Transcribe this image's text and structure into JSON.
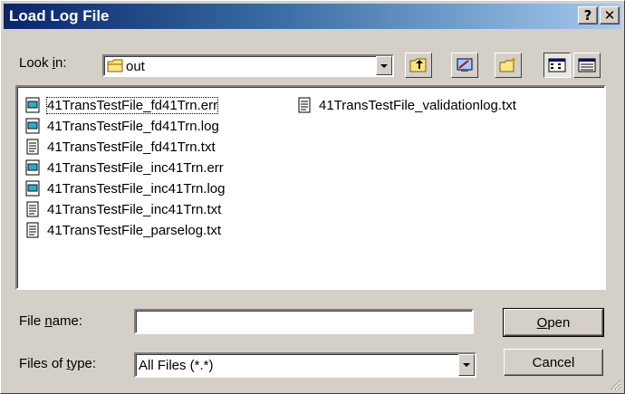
{
  "window": {
    "title": "Load Log File",
    "help_glyph": "?",
    "close_glyph": "✕"
  },
  "lookin": {
    "label_pre": "Look ",
    "label_key": "i",
    "label_post": "n:",
    "value": "out",
    "icon": "folder-icon"
  },
  "toolbar": {
    "buttons": [
      "up-one-level-icon",
      "desktop-icon",
      "new-folder-icon",
      "list-view-icon",
      "details-view-icon"
    ]
  },
  "files": [
    {
      "name": "41TransTestFile_fd41Trn.err",
      "icon": "log-file-icon"
    },
    {
      "name": "41TransTestFile_fd41Trn.log",
      "icon": "log-file-icon"
    },
    {
      "name": "41TransTestFile_fd41Trn.txt",
      "icon": "text-file-icon"
    },
    {
      "name": "41TransTestFile_inc41Trn.err",
      "icon": "log-file-icon"
    },
    {
      "name": "41TransTestFile_inc41Trn.log",
      "icon": "log-file-icon"
    },
    {
      "name": "41TransTestFile_inc41Trn.txt",
      "icon": "text-file-icon"
    },
    {
      "name": "41TransTestFile_parselog.txt",
      "icon": "text-file-icon"
    },
    {
      "name": "41TransTestFile_validationlog.txt",
      "icon": "text-file-icon"
    }
  ],
  "filename": {
    "label_pre": "File ",
    "label_key": "n",
    "label_post": "ame:",
    "value": ""
  },
  "filetype": {
    "label_pre": "Files of ",
    "label_key": "t",
    "label_post": "ype:",
    "value": "All Files (*.*)"
  },
  "buttons": {
    "open_key": "O",
    "open_rest": "pen",
    "cancel": "Cancel"
  },
  "colors": {
    "face": "#d4d0c8",
    "title_start": "#0a246a",
    "title_end": "#a6caf0"
  }
}
